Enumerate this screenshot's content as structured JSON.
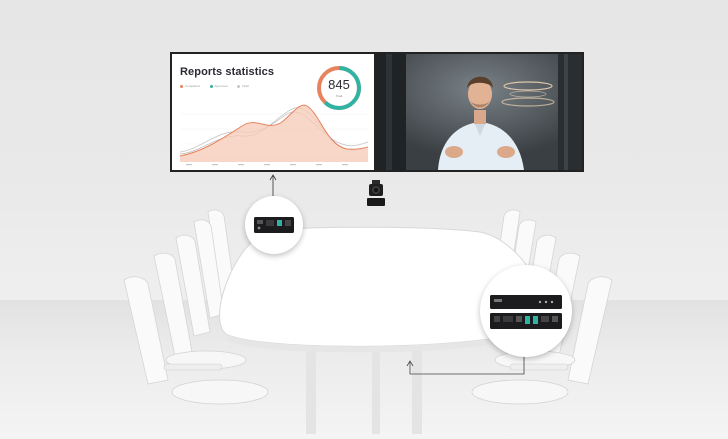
{
  "left_screen": {
    "title": "Reports statistics",
    "legend": [
      {
        "label": "Completed",
        "color": "#e8835f"
      },
      {
        "label": "Approved",
        "color": "#2fb3a3"
      },
      {
        "label": "Draft",
        "color": "#c8c8c8"
      }
    ],
    "donut": {
      "value": "845",
      "label": "Total",
      "color_teal": "#2fb3a3",
      "color_orange": "#e8835f",
      "teal_fraction": 0.62
    }
  },
  "colors": {
    "accent_orange": "#e8835f",
    "accent_teal": "#2fb3a3",
    "screen_frame": "#1b1b1b"
  },
  "icons": [
    "webcam-icon",
    "video-extender-device-icon",
    "switcher-device-icon"
  ]
}
